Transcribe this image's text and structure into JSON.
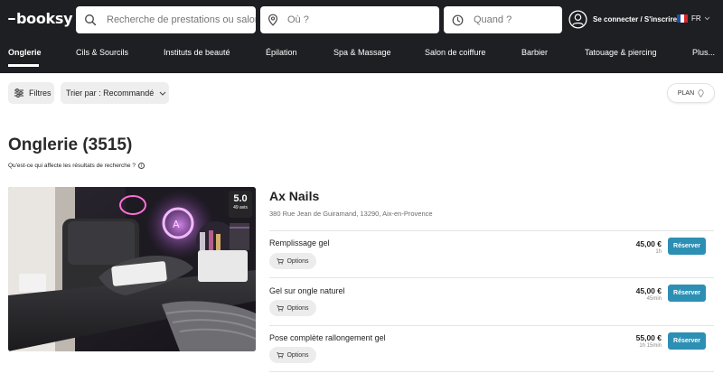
{
  "brand": {
    "logo_text": "booksy"
  },
  "search": {
    "service_placeholder": "Recherche de prestations ou salons",
    "where_placeholder": "Où ?",
    "when_placeholder": "Quand ?"
  },
  "user": {
    "login_label": "Se connecter / S'inscrire"
  },
  "language": {
    "code": "FR",
    "flag_colors": [
      "#1f4fa8",
      "#ffffff",
      "#d8262c"
    ]
  },
  "categories": [
    {
      "label": "Onglerie",
      "active": true
    },
    {
      "label": "Cils & Sourcils"
    },
    {
      "label": "Instituts de beauté"
    },
    {
      "label": "Épilation"
    },
    {
      "label": "Spa & Massage"
    },
    {
      "label": "Salon de coiffure"
    },
    {
      "label": "Barbier"
    },
    {
      "label": "Tatouage & piercing"
    },
    {
      "label": "Plus..."
    }
  ],
  "toolbar": {
    "filters_label": "Filtres",
    "sort_label": "Trier par : Recommandé",
    "map_label": "PLAN"
  },
  "results": {
    "title": "Onglerie (3515)",
    "info_text": "Qu'est-ce qui affecte les résultats de recherche ?"
  },
  "salon": {
    "name": "Ax Nails",
    "address": "380 Rue Jean de Guiramand, 13290, Aix-en-Provence",
    "rating": "5.0",
    "reviews": "49 avis",
    "services": [
      {
        "name": "Remplissage gel",
        "price": "45,00 €",
        "duration": "1h",
        "options_label": "Options",
        "book_label": "Réserver"
      },
      {
        "name": "Gel sur ongle naturel",
        "price": "45,00 €",
        "duration": "45min",
        "options_label": "Options",
        "book_label": "Réserver"
      },
      {
        "name": "Pose complète rallongement gel",
        "price": "55,00 €",
        "duration": "1h 15min",
        "options_label": "Options",
        "book_label": "Réserver"
      }
    ]
  },
  "colors": {
    "header_bg": "#1e1f22",
    "accent": "#2d8fb4"
  }
}
